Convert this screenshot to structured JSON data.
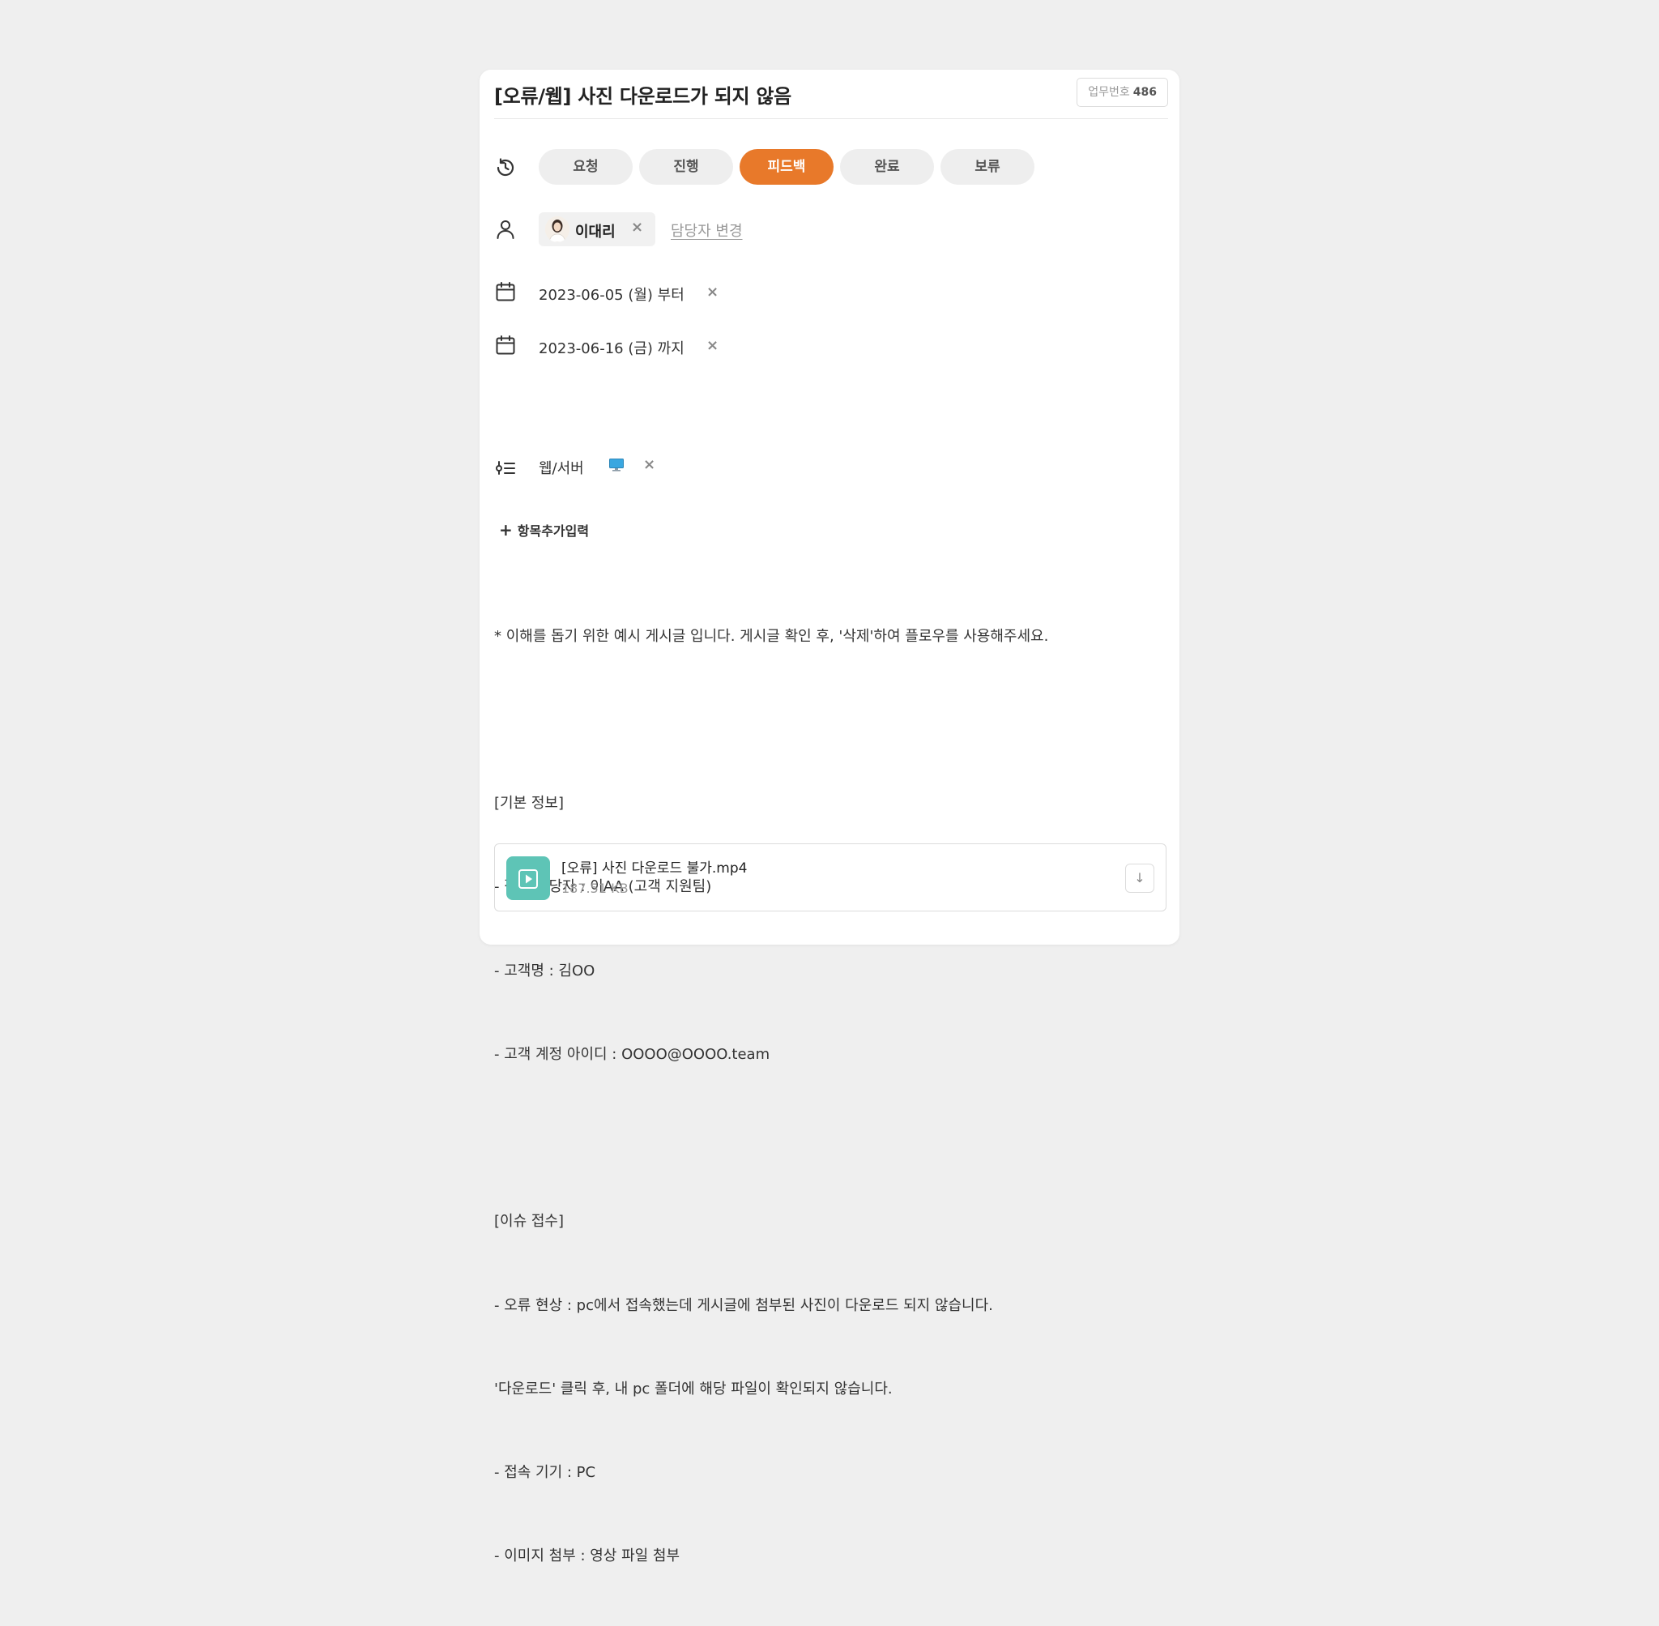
{
  "task": {
    "title": "[오류/웹] 사진 다운로드가 되지 않음",
    "number_label": "업무번호",
    "number": "486"
  },
  "status": {
    "options": [
      "요청",
      "진행",
      "피드백",
      "완료",
      "보류"
    ],
    "active": "피드백",
    "active_color": "#e8792a"
  },
  "assignee": {
    "name": "이대리",
    "remove_icon": "×",
    "change_label": "담당자 변경"
  },
  "dates": {
    "start": "2023-06-05 (월) 부터",
    "end": "2023-06-16 (금) 까지",
    "remove_icon": "×"
  },
  "category": {
    "label": "웹/서버",
    "remove_icon": "×"
  },
  "add_field_label": "항목추가입력",
  "body_lines": [
    "* 이해를 돕기 위한 예시 게시글 입니다. 게시글 확인 후, '삭제'하여 플로우를 사용해주세요.",
    "",
    "[기본 정보]",
    "- 접수 담당자 : 이AA (고객 지원팀)",
    "- 고객명 : 김OO",
    "- 고객 계정 아이디 : OOOO@OOOO.team",
    "",
    "[이슈 접수]",
    "- 오류 현상 : pc에서 접속했는데 게시글에 첨부된 사진이 다운로드 되지 않습니다.",
    "'다운로드' 클릭 후, 내 pc 폴더에 해당 파일이 확인되지 않습니다.",
    "- 접속 기기 : PC",
    "- 이미지 첨부 : 영상 파일 첨부"
  ],
  "attachment": {
    "name": "[오류] 사진 다운로드 불가.mp4",
    "size": "187.51 KB",
    "icon": "video-file-icon"
  }
}
